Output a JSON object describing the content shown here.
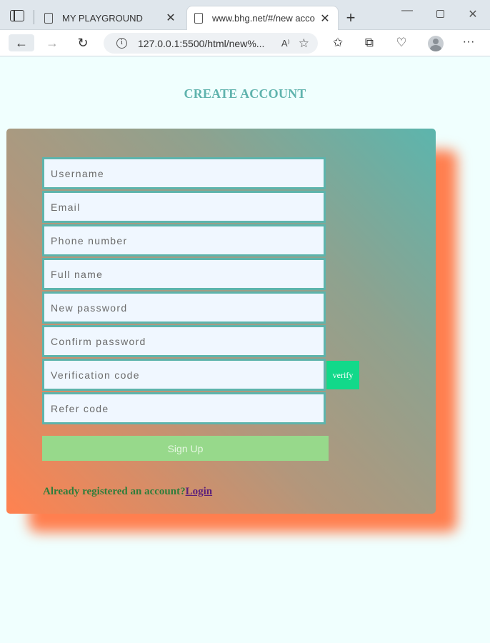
{
  "browser": {
    "tabs": [
      {
        "title": "MY PLAYGROUND",
        "close": "✕"
      },
      {
        "title": "www.bhg.net/#/new account",
        "close": "✕"
      }
    ],
    "new_tab": "+",
    "window_controls": {
      "minimize": "—",
      "maximize": "",
      "close": "✕"
    },
    "nav": {
      "back": "←",
      "forward": "→",
      "reload": "↻"
    },
    "address": {
      "info": "i",
      "url": "127.0.0.1:5500/html/new%...",
      "read_aloud": "A⁾",
      "add_favorite": "☆"
    },
    "toolbar_icons": {
      "favorites": "✩",
      "collections": "⧉",
      "health": "♡",
      "more": "···"
    }
  },
  "page": {
    "title": "CREATE ACCOUNT",
    "form": {
      "username_placeholder": "Username",
      "email_placeholder": "Email",
      "phone_placeholder": "Phone number",
      "fullname_placeholder": "Full name",
      "new_password_placeholder": "New password",
      "confirm_password_placeholder": "Confirm password",
      "verification_placeholder": "Verification code",
      "refer_placeholder": "Refer code",
      "verify_label": "verify",
      "signup_label": "Sign Up"
    },
    "login_prompt": "Already registered an account?",
    "login_link": "Login"
  },
  "colors": {
    "page_bg": "#f0fffe",
    "title": "#5fb3ad",
    "card_gradient_start": "#ff8250",
    "card_gradient_end": "#5cb5ad",
    "field_border": "#5db4ac",
    "verify_bg": "#12d98a",
    "signup_bg": "#97d98b",
    "login_text": "#2e7d3a"
  }
}
